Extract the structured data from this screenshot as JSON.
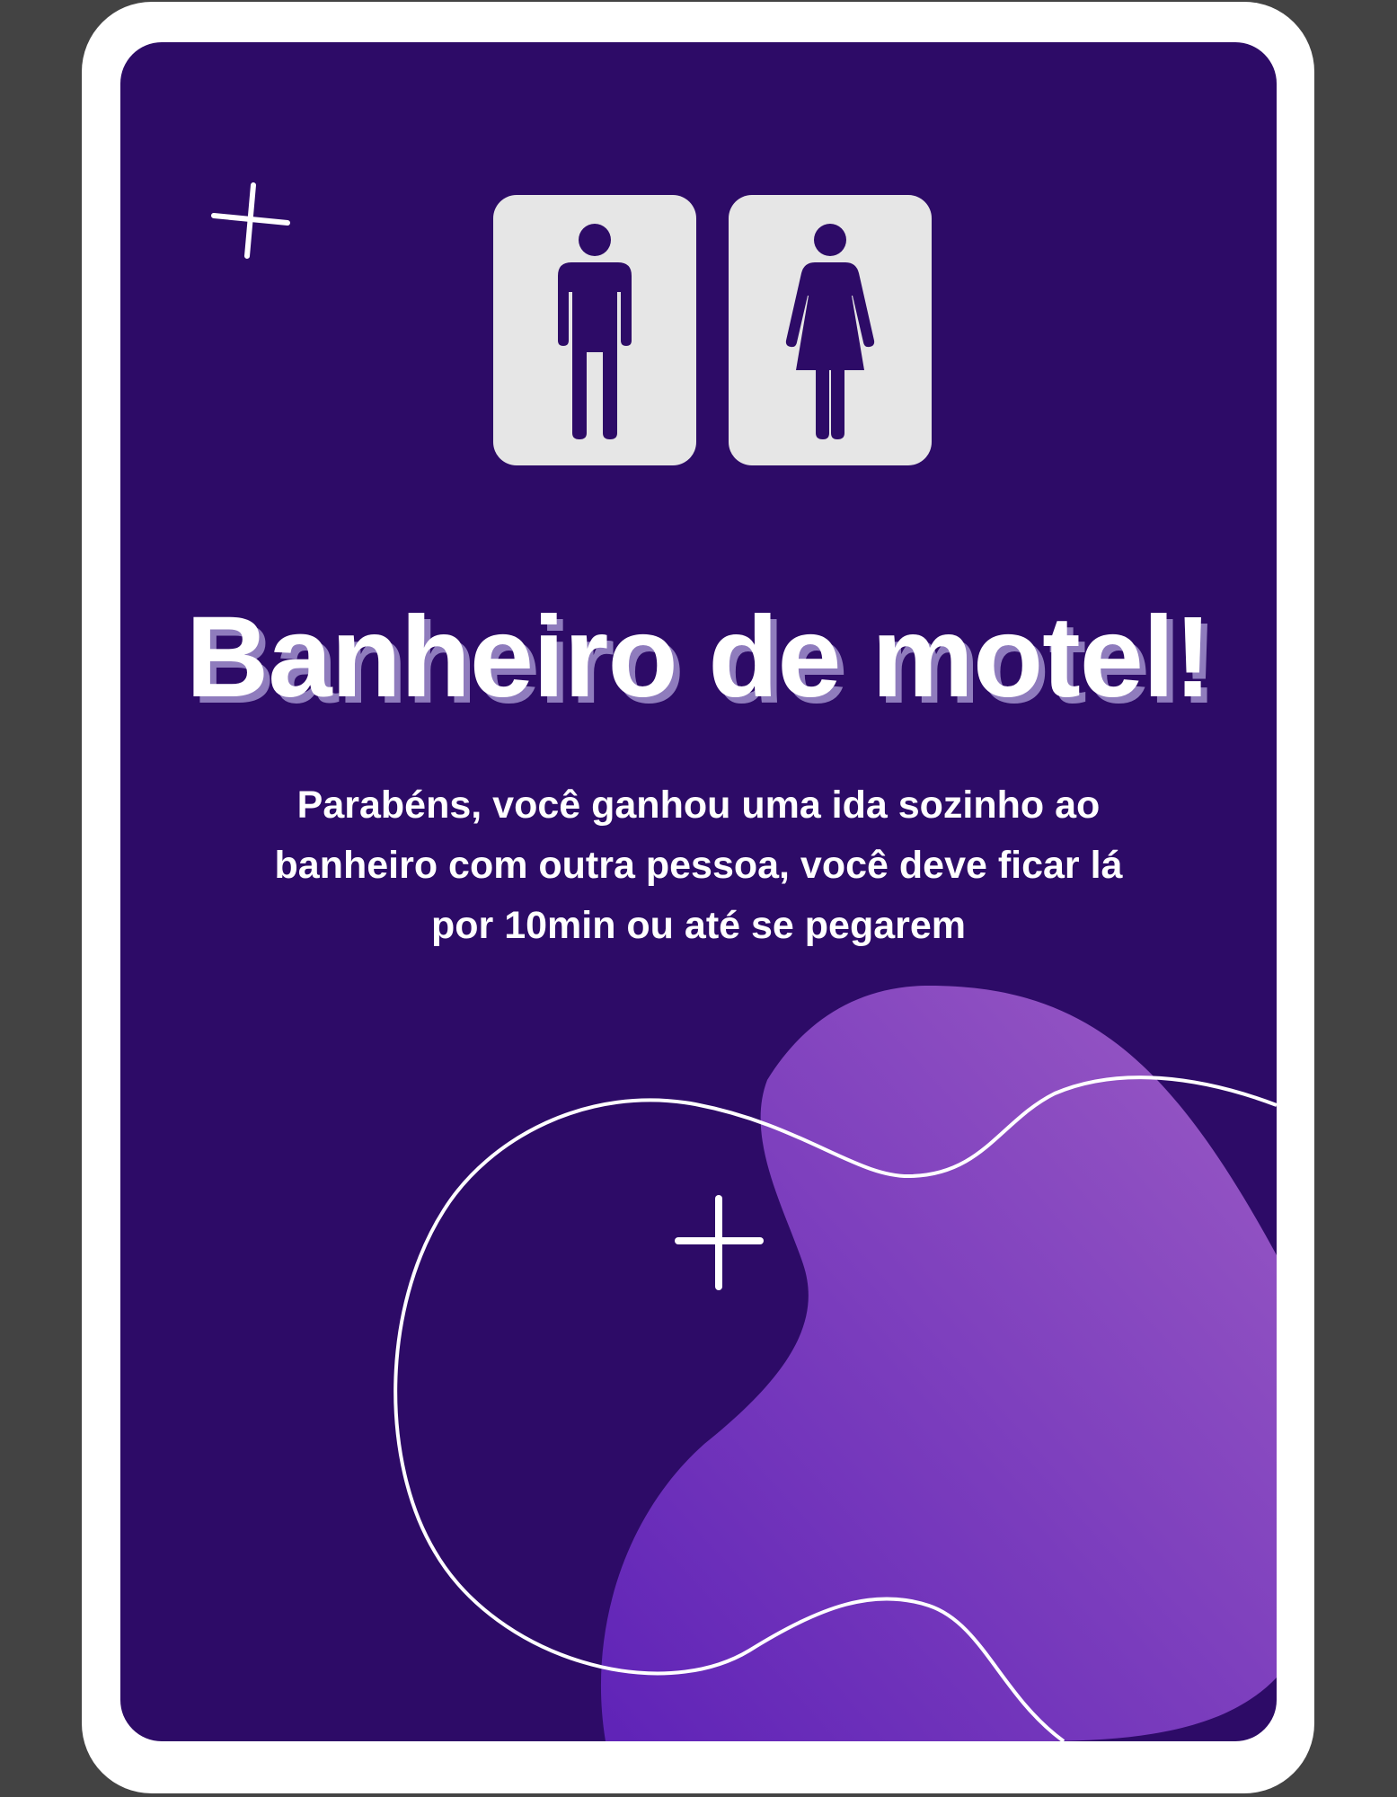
{
  "card": {
    "title": "Banheiro de motel!",
    "description": "Parabéns, você ganhou uma ida sozinho ao banheiro com outra pessoa, você deve ficar lá por 10min ou até se pegarem"
  },
  "icons": {
    "male": "male-restroom-icon",
    "female": "female-restroom-icon",
    "sparkle": "plus-sparkle-icon"
  },
  "colors": {
    "background": "#434343",
    "frame": "#ffffff",
    "card": "#2d0b67",
    "blob_light": "#9a5ac4",
    "blob_dark": "#5f23b7",
    "sign_tile": "#e6e6e6",
    "title_shadow": "#8f7cbd"
  }
}
